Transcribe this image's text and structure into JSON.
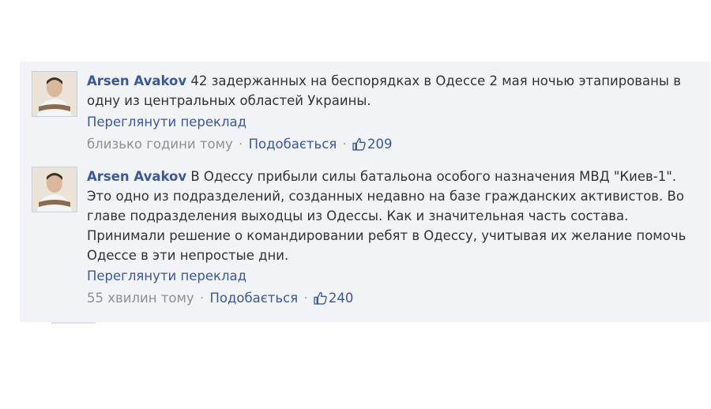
{
  "posts": [
    {
      "author": "Arsen Avakov",
      "message": "42 задержанных на беспорядках в Одессе 2 мая ночью этапированы в одну из центральных областей Украины.",
      "translate": "Переглянути переклад",
      "time": "близько години тому",
      "like": "Подобається",
      "likes": "209"
    },
    {
      "author": "Arsen Avakov",
      "message": "В Одессу прибыли силы батальона особого назначения МВД \"Киев-1\". Это одно из подразделений, созданных недавно на базе гражданских активистов. Во главе подразделения выходцы из Одессы. Как и значительная часть состава. Принимали решение о командировании ребят в Одессу, учитывая их желание помочь Одессе в эти непростые дни.",
      "translate": "Переглянути переклад",
      "time": "55 хвилин тому",
      "like": "Подобається",
      "likes": "240"
    }
  ],
  "colors": {
    "link": "#3b5998",
    "text": "#333333",
    "muted": "#909090",
    "feed_bg": "#f2f3f6"
  },
  "icons": {
    "avatar": "profile-photo",
    "like": "thumbs-up-icon"
  }
}
